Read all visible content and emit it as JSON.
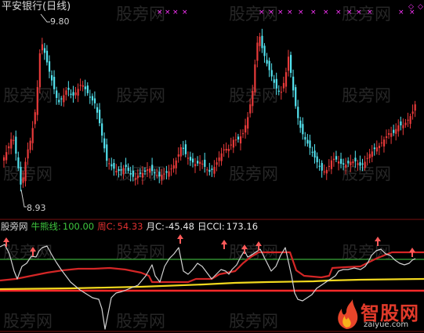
{
  "title": "平安银行(日线)",
  "watermark_text": "股旁网",
  "price_labels": {
    "high": "9.80",
    "low": "8.93"
  },
  "legend": {
    "source": "股旁网",
    "bull_label": "牛熊线:",
    "bull_value": "100.00",
    "week_label": "周C:",
    "week_value": "54.33",
    "month_label": "月C:",
    "month_value": "-45.48",
    "day_label": "日CCI:",
    "day_value": "173.16"
  },
  "logo": {
    "name": "智股网",
    "url": "zaiyue.com"
  },
  "colors": {
    "up": "#e83a3a",
    "down": "#54e3ef",
    "bull_line": "#3aa83a",
    "week_line": "#d42626",
    "month_line": "#f2d81e",
    "day_line": "#d2d2d2",
    "base_line": "#ff2a2a",
    "cross": "#ff34ff",
    "up_arrow": "#ff5a5a"
  },
  "chart_data": [
    {
      "type": "candlestick",
      "title": "平安银行(日线)",
      "y_high_label": 9.8,
      "y_low_label": 8.93,
      "ylim": [
        8.93,
        9.8
      ]
    },
    {
      "type": "line",
      "series": [
        {
          "name": "牛熊线",
          "last_value": 100.0
        },
        {
          "name": "周C",
          "last_value": 54.33
        },
        {
          "name": "月C",
          "last_value": -45.48
        },
        {
          "name": "日CCI",
          "last_value": 173.16
        }
      ]
    }
  ]
}
